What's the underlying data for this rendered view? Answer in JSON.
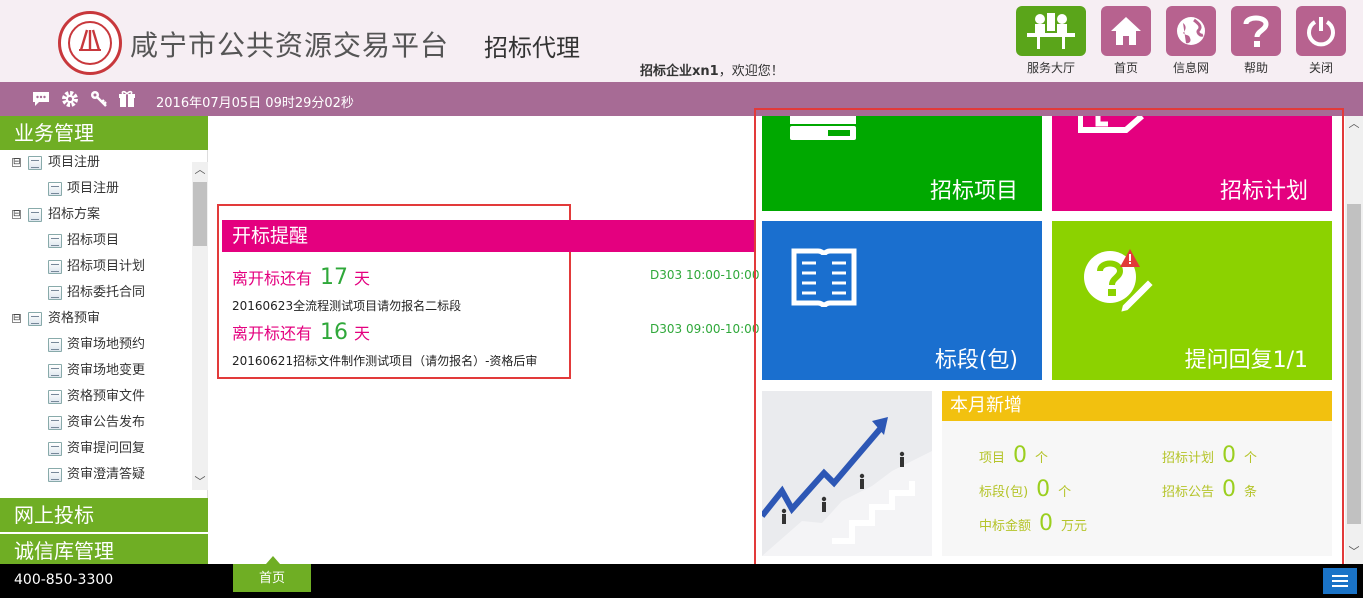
{
  "header": {
    "site_title": "咸宁市公共资源交易平台",
    "module_title": "招标代理",
    "welcome_user": "招标企业xn1",
    "welcome_suffix": "，欢迎您！",
    "nav": {
      "hall": "服务大厅",
      "home": "首页",
      "info": "信息网",
      "help": "帮助",
      "close": "关闭"
    }
  },
  "toolbar": {
    "datetime": "2016年07月05日 09时29分02秒",
    "icons": [
      "chat-icon",
      "gear-icon",
      "key-icon",
      "gift-icon"
    ]
  },
  "sidebar": {
    "section_business": "业务管理",
    "tree": [
      {
        "level": 1,
        "expander": "⊟",
        "label": "项目注册"
      },
      {
        "level": 2,
        "label": "项目注册"
      },
      {
        "level": 1,
        "expander": "⊟",
        "label": "招标方案"
      },
      {
        "level": 2,
        "label": "招标项目"
      },
      {
        "level": 2,
        "label": "招标项目计划"
      },
      {
        "level": 2,
        "label": "招标委托合同"
      },
      {
        "level": 1,
        "expander": "⊟",
        "label": "资格预审"
      },
      {
        "level": 2,
        "label": "资审场地预约"
      },
      {
        "level": 2,
        "label": "资审场地变更"
      },
      {
        "level": 2,
        "label": "资格预审文件"
      },
      {
        "level": 2,
        "label": "资审公告发布"
      },
      {
        "level": 2,
        "label": "资审提问回复"
      },
      {
        "level": 2,
        "label": "资审澄清答疑"
      }
    ],
    "section_online_bid": "网上投标",
    "section_credit": "诚信库管理"
  },
  "reminder": {
    "title": "开标提醒",
    "items": [
      {
        "lead": "离开标还有",
        "days": "17",
        "unit": "天",
        "project": "20160623全流程测试项目请勿报名二标段",
        "slot": "D303 10:00-10:00"
      },
      {
        "lead": "离开标还有",
        "days": "16",
        "unit": "天",
        "project": "20160621招标文件制作测试项目（请勿报名）-资格后审",
        "slot": "D303 09:00-10:00"
      }
    ]
  },
  "tiles": {
    "bid_project": "招标项目",
    "bid_plan": "招标计划",
    "section": "标段(包)",
    "qa_reply": "提问回复1/1"
  },
  "monthly": {
    "title": "本月新增",
    "stats": {
      "project": {
        "label": "项目",
        "value": "0",
        "unit": "个"
      },
      "plan": {
        "label": "招标计划",
        "value": "0",
        "unit": "个"
      },
      "section": {
        "label": "标段(包)",
        "value": "0",
        "unit": "个"
      },
      "notice": {
        "label": "招标公告",
        "value": "0",
        "unit": "条"
      },
      "amount": {
        "label": "中标金额",
        "value": "0",
        "unit": "万元"
      }
    }
  },
  "footer": {
    "phone": "400-850-3300",
    "home_tab": "首页"
  },
  "colors": {
    "header_bg": "#f6eef3",
    "toolbar_bg": "#a76b95",
    "sidebar_green": "#6fae24",
    "tile_green": "#00a800",
    "tile_magenta": "#e4007f",
    "tile_blue": "#1a6fcf",
    "tile_lime": "#8cd200",
    "monthly_yellow": "#f2c10f",
    "highlight_red": "#e23a3a"
  }
}
